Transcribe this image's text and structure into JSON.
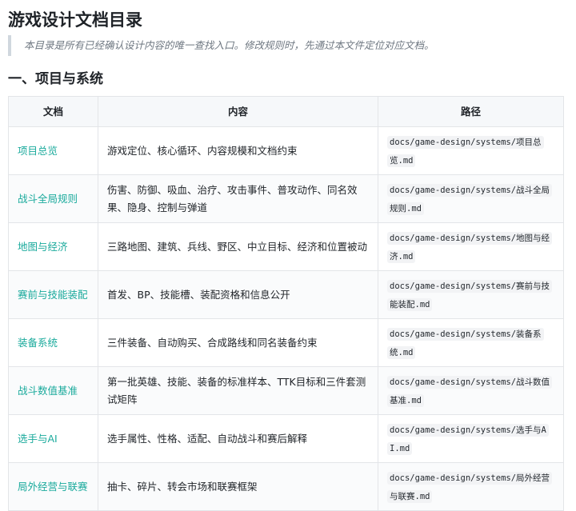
{
  "page": {
    "title": "游戏设计文档目录",
    "intro": "本目录是所有已经确认设计内容的唯一查找入口。修改规则时，先通过本文件定位对应文档。"
  },
  "section1": {
    "heading": "一、项目与系统",
    "columns": [
      "文档",
      "内容",
      "路径"
    ],
    "rows": [
      {
        "doc": "项目总览",
        "content": "游戏定位、核心循环、内容规模和文档约束",
        "path": "docs/game-design/systems/项目总览.md"
      },
      {
        "doc": "战斗全局规则",
        "content": "伤害、防御、吸血、治疗、攻击事件、普攻动作、同名效果、隐身、控制与弹道",
        "path": "docs/game-design/systems/战斗全局规则.md"
      },
      {
        "doc": "地图与经济",
        "content": "三路地图、建筑、兵线、野区、中立目标、经济和位置被动",
        "path": "docs/game-design/systems/地图与经济.md"
      },
      {
        "doc": "赛前与技能装配",
        "content": "首发、BP、技能槽、装配资格和信息公开",
        "path": "docs/game-design/systems/赛前与技能装配.md"
      },
      {
        "doc": "装备系统",
        "content": "三件装备、自动购买、合成路线和同名装备约束",
        "path": "docs/game-design/systems/装备系统.md"
      },
      {
        "doc": "战斗数值基准",
        "content": "第一批英雄、技能、装备的标准样本、TTK目标和三件套测试矩阵",
        "path": "docs/game-design/systems/战斗数值基准.md"
      },
      {
        "doc": "选手与AI",
        "content": "选手属性、性格、适配、自动战斗和赛后解释",
        "path": "docs/game-design/systems/选手与AI.md"
      },
      {
        "doc": "局外经营与联赛",
        "content": "抽卡、碎片、转会市场和联赛框架",
        "path": "docs/game-design/systems/局外经营与联赛.md"
      }
    ]
  },
  "colors": {
    "link": "#1aaa9c",
    "quote_bar": "#d0d7de",
    "header_bg": "#f6f8fa",
    "border": "#e3e5e8"
  }
}
